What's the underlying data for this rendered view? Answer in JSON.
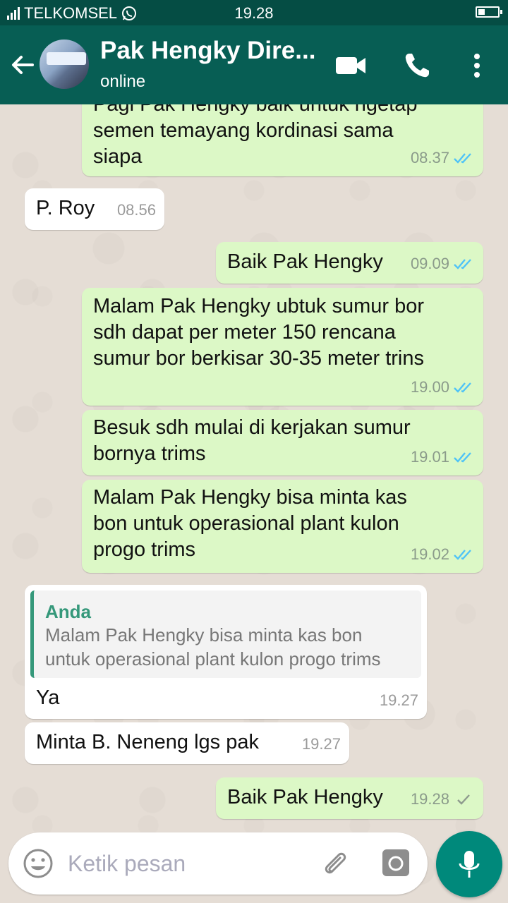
{
  "status_bar": {
    "carrier": "TELKOMSEL",
    "time": "19.28"
  },
  "header": {
    "contact_name": "Pak Hengky Dire...",
    "status": "online"
  },
  "messages": [
    {
      "direction": "out",
      "text_line1": "Pagi Pak Hengky baik untuk ngetap",
      "text_line2": "semen temayang kordinasi sama",
      "text_line3": "siapa",
      "time": "08.37",
      "receipt": "read"
    },
    {
      "direction": "in",
      "text": "P. Roy",
      "time": "08.56"
    },
    {
      "direction": "out",
      "text": "Baik Pak Hengky",
      "time": "09.09",
      "receipt": "read"
    },
    {
      "direction": "out",
      "text_line1": "Malam Pak Hengky ubtuk sumur bor",
      "text_line2": "sdh dapat per meter 150 rencana",
      "text_line3": "sumur bor berkisar 30-35 meter trins",
      "time": "19.00",
      "receipt": "read"
    },
    {
      "direction": "out",
      "text_line1": "Besuk sdh mulai di kerjakan sumur",
      "text_line2": "bornya trims",
      "time": "19.01",
      "receipt": "read"
    },
    {
      "direction": "out",
      "text_line1": "Malam Pak Hengky bisa minta kas",
      "text_line2": "bon untuk operasional plant kulon",
      "text_line3": "progo trims",
      "time": "19.02",
      "receipt": "read"
    },
    {
      "direction": "in",
      "quote_author": "Anda",
      "quote_line1": "Malam Pak Hengky bisa minta kas bon",
      "quote_line2": "untuk operasional plant kulon progo trims",
      "text": "Ya",
      "time": "19.27"
    },
    {
      "direction": "in",
      "text": "Minta B. Neneng lgs pak",
      "time": "19.27"
    },
    {
      "direction": "out",
      "text": "Baik Pak Hengky",
      "time": "19.28",
      "receipt": "sent"
    }
  ],
  "composer": {
    "placeholder": "Ketik pesan"
  },
  "colors": {
    "header": "#075e54",
    "status_bar": "#054d44",
    "outgoing_bubble": "#dcf8c6",
    "incoming_bubble": "#ffffff",
    "read_tick": "#4fc3f7",
    "mic_button": "#00897b"
  }
}
